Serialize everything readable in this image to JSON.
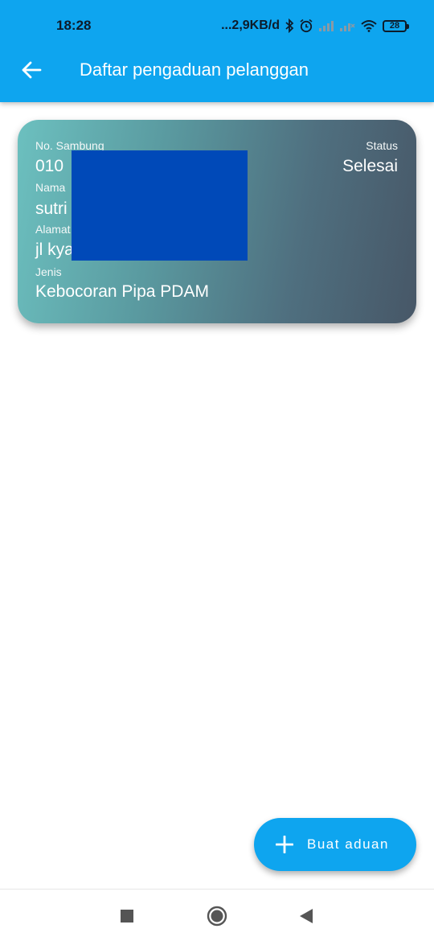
{
  "status_bar": {
    "time": "18:28",
    "network_speed": "...2,9KB/d",
    "battery": "28"
  },
  "app_bar": {
    "title": "Daftar pengaduan pelanggan",
    "back_icon": "arrow-left-icon"
  },
  "complaint": {
    "no_sambung_label": "No. Sambung",
    "no_sambung_value": "010",
    "nama_label": "Nama",
    "nama_value": "sutri",
    "alamat_label": "Alamat",
    "alamat_value": "jl kya",
    "jenis_label": "Jenis",
    "jenis_value": "Kebocoran Pipa PDAM",
    "status_label": "Status",
    "status_value": "Selesai"
  },
  "fab": {
    "label": "Buat aduan",
    "icon": "plus-icon"
  },
  "colors": {
    "primary": "#0ea5ef",
    "redaction": "#0049b8"
  }
}
